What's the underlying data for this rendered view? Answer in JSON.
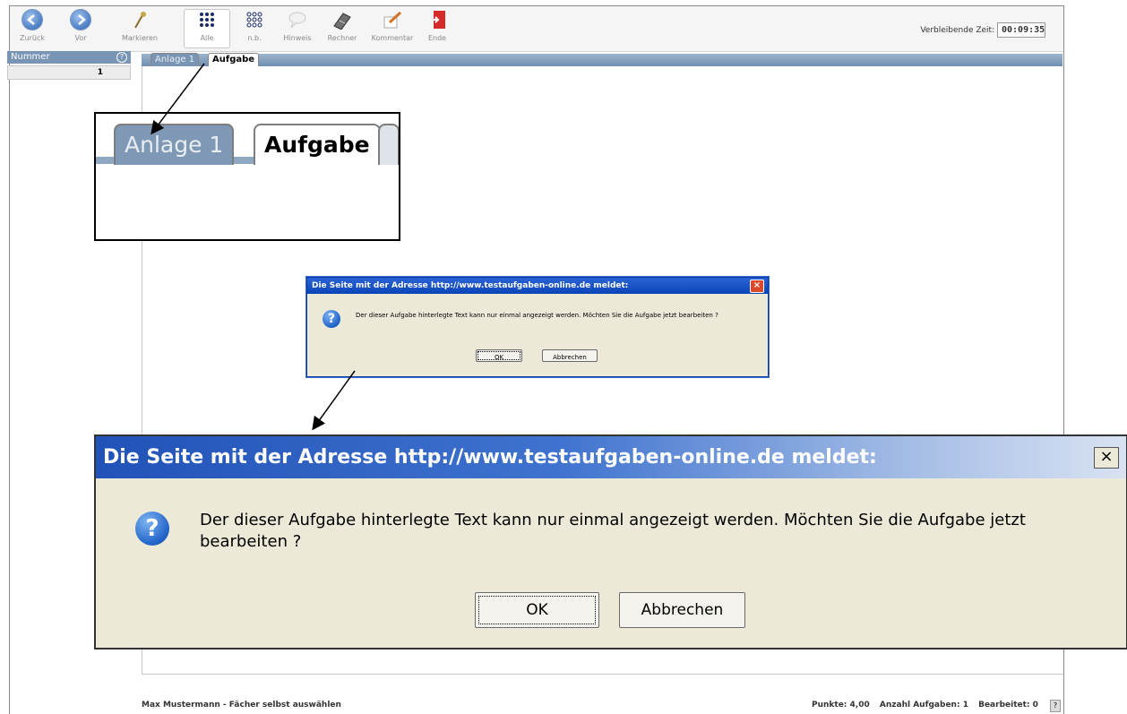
{
  "toolbar": {
    "back": "Zurück",
    "forward": "Vor",
    "mark": "Markieren",
    "all": "Alle",
    "nb": "n.b.",
    "hint": "Hinweis",
    "calculator": "Rechner",
    "comment": "Kommentar",
    "end": "Ende",
    "timer_label": "Verbleibende Zeit:",
    "timer_value": "00:09:35"
  },
  "left_panel": {
    "header": "Nummer",
    "help": "?",
    "rows": [
      "1"
    ]
  },
  "tabs": [
    {
      "label": "Anlage 1",
      "active": false
    },
    {
      "label": "Aufgabe",
      "active": true
    }
  ],
  "dialog": {
    "title": "Die Seite mit der Adresse http://www.testaufgaben-online.de meldet:",
    "message": "Der dieser Aufgabe hinterlegte Text kann nur einmal angezeigt werden. Möchten Sie die Aufgabe jetzt bearbeiten ?",
    "ok": "OK",
    "cancel": "Abbrechen",
    "close": "×",
    "icon_glyph": "?"
  },
  "footer": {
    "user": "Max Mustermann - Fächer selbst auswählen",
    "points": "Punkte: 4,00",
    "tasks": "Anzahl Aufgaben: 1",
    "done": "Bearbeitet: 0",
    "help": "?"
  },
  "colors": {
    "tab_strip": "#7f98b5",
    "title_bar": "#0a45b8",
    "dialog_bg": "#ece9d8"
  }
}
